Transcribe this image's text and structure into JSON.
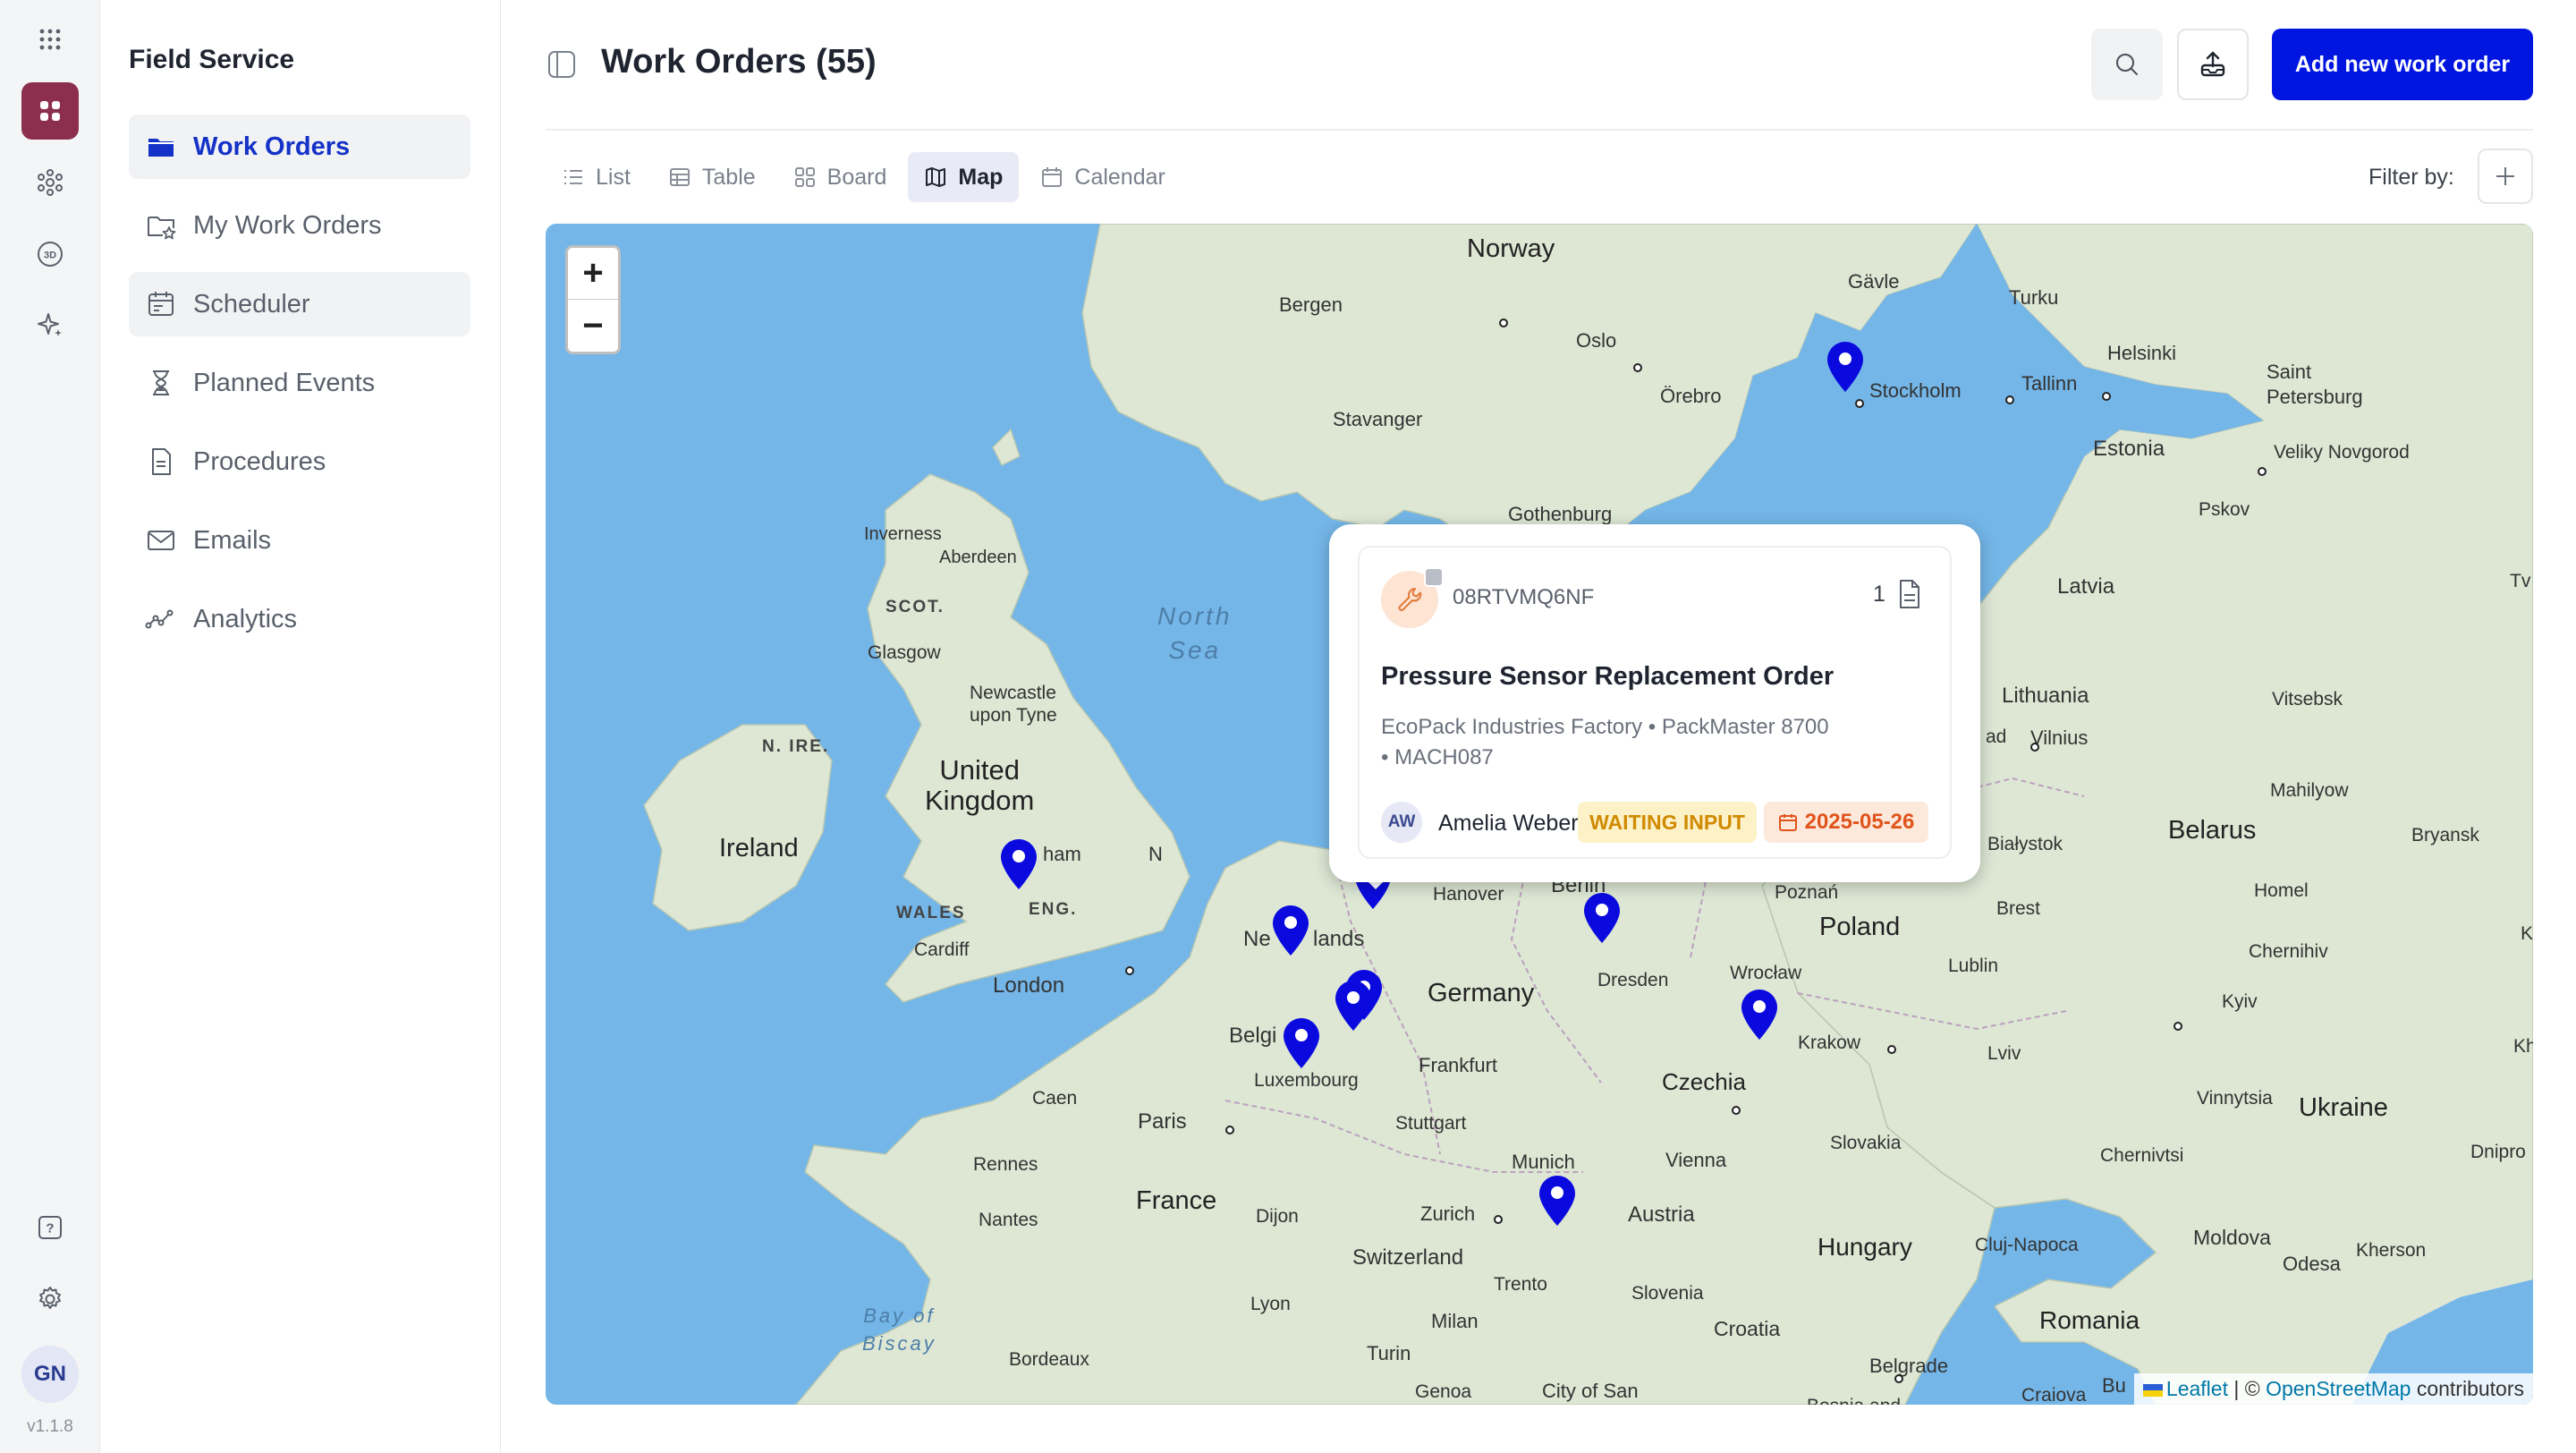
{
  "app": {
    "name": "Field Service",
    "version": "v1.1.8",
    "user_initials": "GN"
  },
  "rail": {
    "icons": [
      "apps-grid-icon",
      "modules-icon",
      "network-icon",
      "3d-icon",
      "sparkle-icon",
      "help-icon",
      "gear-icon"
    ],
    "badge_3d": "3D",
    "help_mark": "?"
  },
  "sidebar": {
    "title": "Field Service",
    "items": [
      {
        "label": "Work Orders",
        "icon": "folder-icon",
        "active": true
      },
      {
        "label": "My Work Orders",
        "icon": "folder-star-icon"
      },
      {
        "label": "Scheduler",
        "icon": "calendar-icon"
      },
      {
        "label": "Planned Events",
        "icon": "hourglass-icon"
      },
      {
        "label": "Procedures",
        "icon": "document-icon"
      },
      {
        "label": "Emails",
        "icon": "mail-icon"
      },
      {
        "label": "Analytics",
        "icon": "analytics-icon"
      }
    ]
  },
  "header": {
    "title": "Work Orders (55)",
    "add_button": "Add new work order"
  },
  "views": {
    "tabs": [
      {
        "label": "List",
        "icon": "list-icon"
      },
      {
        "label": "Table",
        "icon": "table-icon"
      },
      {
        "label": "Board",
        "icon": "board-icon"
      },
      {
        "label": "Map",
        "icon": "map-icon",
        "active": true
      },
      {
        "label": "Calendar",
        "icon": "calendar-icon"
      }
    ],
    "filter_label": "Filter by:"
  },
  "map": {
    "zoom_in": "+",
    "zoom_out": "−",
    "labels": {
      "norway": "Norway",
      "bergen": "Bergen",
      "oslo": "Oslo",
      "stavanger": "Stavanger",
      "gavle": "Gävle",
      "turku": "Turku",
      "helsinki": "Helsinki",
      "saint_petersburg": "Saint\nPetersburg",
      "orebro": "Örebro",
      "stockholm": "Stockholm",
      "tallinn": "Tallinn",
      "estonia": "Estonia",
      "veliky": "Veliky Novgorod",
      "pskov": "Pskov",
      "gothenburg": "Gothenburg",
      "inverness": "Inverness",
      "aberdeen": "Aberdeen",
      "scot": "SCOT.",
      "glasgow": "Glasgow",
      "north_sea": "North\nSea",
      "newcastle": "Newcastle\nupon Tyne",
      "n_ire": "N. IRE.",
      "uk": "United\nKingdom",
      "ireland": "Ireland",
      "wales": "WALES",
      "eng": "ENG.",
      "cardiff": "Cardiff",
      "london": "London",
      "latvia": "Latvia",
      "lithuania": "Lithuania",
      "vilnius": "Vilnius",
      "vitsebsk": "Vitsebsk",
      "mahilyow": "Mahilyow",
      "belarus": "Belarus",
      "bryansk": "Bryansk",
      "bialystok": "Białystok",
      "hanover": "Hanover",
      "berlin": "Berlin",
      "poznan": "Poznań",
      "poland": "Poland",
      "brest": "Brest",
      "homel": "Homel",
      "chernihiv": "Chernihiv",
      "netherlands_a": "Ne",
      "netherlands_b": "lands",
      "germany": "Germany",
      "dresden": "Dresden",
      "wroclaw": "Wrocław",
      "lublin": "Lublin",
      "kyiv": "Kyiv",
      "belgium_a": "Belgi",
      "belgium_b": "n",
      "luxembourg": "Luxembourg",
      "frankfurt": "Frankfurt",
      "czechia": "Czechia",
      "krakow": "Krakow",
      "lviv": "Lviv",
      "caen": "Caen",
      "paris": "Paris",
      "stuttgart": "Stuttgart",
      "vinnytsia": "Vinnytsia",
      "ukraine": "Ukraine",
      "rennes": "Rennes",
      "munich": "Munich",
      "vienna": "Vienna",
      "slovakia": "Slovakia",
      "chernivtsi": "Chernivtsi",
      "france": "France",
      "nantes": "Nantes",
      "dijon": "Dijon",
      "zurich": "Zurich",
      "austria": "Austria",
      "hungary": "Hungary",
      "cluj": "Cluj-Napoca",
      "moldova": "Moldova",
      "odesa": "Odesa",
      "kherson": "Kherson",
      "switzerland": "Switzerland",
      "lyon": "Lyon",
      "trento": "Trento",
      "slovenia": "Slovenia",
      "milan": "Milan",
      "croatia": "Croatia",
      "romania": "Romania",
      "bay_biscay": "Bay of\nBiscay",
      "bordeaux": "Bordeaux",
      "turin": "Turin",
      "belgrade": "Belgrade",
      "genoa": "Genoa",
      "city_of_san": "City of San",
      "craiova": "Craiova",
      "dnipro": "Dnipro",
      "bu": "Bu",
      "edge_tv": "Tv",
      "edge_k": "K",
      "edge_kh": "Kh",
      "edge_ad": "ad",
      "nottingham_a": "N",
      "nottingham_b": "ham",
      "bosnia": "Bosnia and"
    },
    "attribution": {
      "leaflet": "Leaflet",
      "sep": "| ©",
      "osm": "OpenStreetMap",
      "contributors": "contributors"
    }
  },
  "popup": {
    "id": "08RTVMQ6NF",
    "attachments": "1",
    "title": "Pressure Sensor Replacement Order",
    "meta": "EcoPack Industries Factory  •  PackMaster 8700\n•  MACH087",
    "assignee_initials": "AW",
    "assignee": "Amelia Weber",
    "status": "WAITING INPUT",
    "due": "2025-05-26"
  },
  "colors": {
    "accent": "#0016e0",
    "active_module": "#8c2f4e",
    "pin": "#0a0adf",
    "status_bg": "#fdf1c8",
    "status_fg": "#d08a00"
  }
}
